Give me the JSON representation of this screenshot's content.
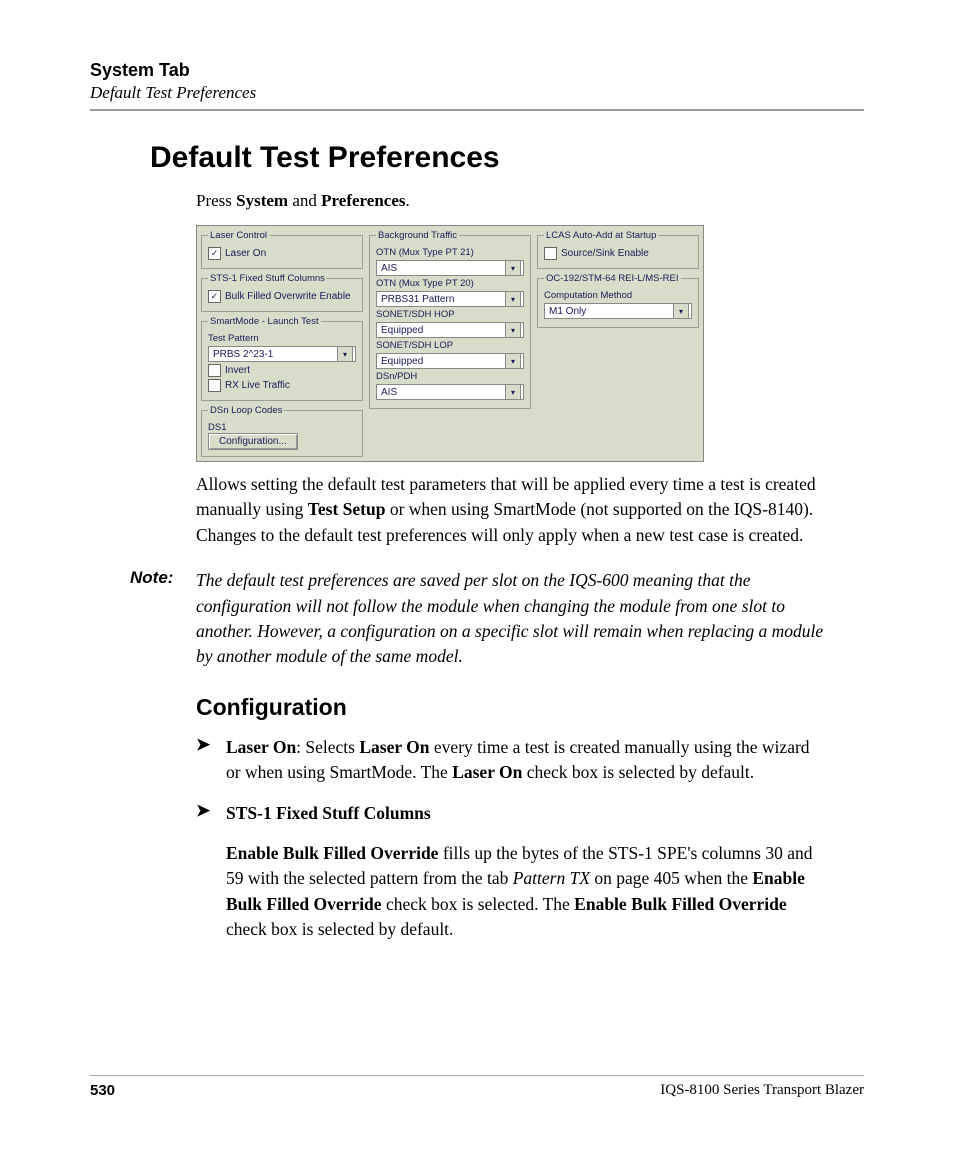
{
  "header": {
    "title": "System Tab",
    "subtitle": "Default Test Preferences"
  },
  "main_title": "Default Test Preferences",
  "intro": {
    "prefix": "Press ",
    "b1": "System",
    "mid": " and ",
    "b2": "Preferences",
    "suffix": "."
  },
  "screenshot": {
    "col1": {
      "laser_control": {
        "legend": "Laser Control",
        "laser_on": "Laser On",
        "laser_on_checked": "✓"
      },
      "sts1": {
        "legend": "STS-1 Fixed Stuff Columns",
        "bulk": "Bulk Filled Overwrite Enable",
        "bulk_checked": "✓"
      },
      "smartmode": {
        "legend": "SmartMode - Launch Test",
        "test_pattern_label": "Test Pattern",
        "test_pattern_value": "PRBS 2^23-1",
        "invert": "Invert",
        "rx_live": "RX Live Traffic"
      },
      "dsn": {
        "legend": "DSn Loop Codes",
        "ds1": "DS1",
        "config_btn": "Configuration..."
      }
    },
    "col2": {
      "bg": {
        "legend": "Background Traffic",
        "otn21_label": "OTN (Mux Type PT 21)",
        "otn21_value": "AIS",
        "otn20_label": "OTN (Mux Type PT 20)",
        "otn20_value": "PRBS31 Pattern",
        "hop_label": "SONET/SDH HOP",
        "hop_value": "Equipped",
        "lop_label": "SONET/SDH LOP",
        "lop_value": "Equipped",
        "dsn_label": "DSn/PDH",
        "dsn_value": "AIS"
      }
    },
    "col3": {
      "lcas": {
        "legend": "LCAS Auto-Add at Startup",
        "src": "Source/Sink Enable"
      },
      "oc192": {
        "legend": "OC-192/STM-64 REI-L/MS-REI",
        "method_label": "Computation Method",
        "method_value": "M1 Only"
      }
    }
  },
  "desc_para": {
    "t1": "Allows setting the default test parameters that will be applied every time a test is created manually using ",
    "b1": "Test Setup",
    "t2": " or when using SmartMode (not supported on the IQS-8140). Changes to the default test preferences will only apply when a new test case is created."
  },
  "note": {
    "label": "Note:",
    "text": "The default test preferences are saved per slot on the IQS-600 meaning that the configuration will not follow the module when changing the module from one slot to another. However, a configuration on a specific slot will remain when replacing a module by another module of the same model."
  },
  "config_heading": "Configuration",
  "bullets": {
    "b1": {
      "lead_bold": "Laser On",
      "t1": ": Selects ",
      "b2": "Laser On",
      "t2": " every time a test is created manually using the wizard or when using SmartMode. The ",
      "b3": "Laser On",
      "t3": " check box is selected by default."
    },
    "b2": {
      "title": "STS-1 Fixed Stuff Columns",
      "sub_b1": "Enable Bulk Filled Override",
      "sub_t1": " fills up the bytes of the STS-1 SPE's columns 30 and 59 with the selected pattern from the tab ",
      "sub_i1": "Pattern TX",
      "sub_t2": " on page 405 when the ",
      "sub_b2": "Enable Bulk Filled Override",
      "sub_t3": " check box is selected. The ",
      "sub_b3": "Enable Bulk Filled Override",
      "sub_t4": " check box is selected by default."
    }
  },
  "footer": {
    "page": "530",
    "product": "IQS-8100 Series Transport Blazer"
  }
}
